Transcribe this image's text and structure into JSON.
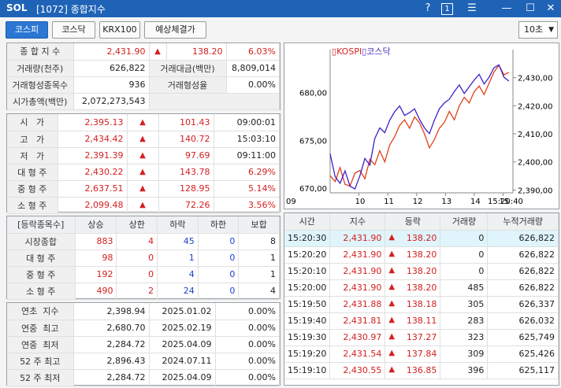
{
  "window": {
    "logo": "SOL",
    "title": "[1072] 종합지수",
    "help": "?",
    "num": "1",
    "menu": "☰",
    "min": "—",
    "max": "☐",
    "close": "✕"
  },
  "tabs": [
    "코스피",
    "코스닥",
    "KRX100",
    "예상체결가"
  ],
  "interval": "10초",
  "summary": {
    "rows": [
      {
        "label": "종 합 지 수",
        "v1": "2,431.90",
        "arrow": "▲",
        "v2": "138.20",
        "v3": "6.03%"
      },
      {
        "label": "거래량(천주)",
        "v1": "626,822",
        "label2": "거래대금(백만)",
        "v2": "8,809,014"
      },
      {
        "label": "거래형성종목수",
        "v1": "936",
        "label2": "거래형성율",
        "v2": "0.00%"
      },
      {
        "label": "시가총액(백만)",
        "v1": "2,072,273,543"
      }
    ]
  },
  "prices": [
    {
      "label": "시   가",
      "v": "2,395.13",
      "arrow": "▲",
      "chg": "101.43",
      "extra": "09:00:01"
    },
    {
      "label": "고   가",
      "v": "2,434.42",
      "arrow": "▲",
      "chg": "140.72",
      "extra": "15:03:10"
    },
    {
      "label": "저   가",
      "v": "2,391.39",
      "arrow": "▲",
      "chg": "97.69",
      "extra": "09:11:00"
    },
    {
      "label": "대 형 주",
      "v": "2,430.22",
      "arrow": "▲",
      "chg": "143.78",
      "extra": "6.29%"
    },
    {
      "label": "중 형 주",
      "v": "2,637.51",
      "arrow": "▲",
      "chg": "128.95",
      "extra": "5.14%"
    },
    {
      "label": "소 형 주",
      "v": "2,099.48",
      "arrow": "▲",
      "chg": "72.26",
      "extra": "3.56%"
    }
  ],
  "breadth": {
    "headers": [
      "[등락종목수]",
      "상승",
      "상한",
      "하락",
      "하한",
      "보합"
    ],
    "rows": [
      {
        "label": "시장종합",
        "up": "883",
        "uplim": "4",
        "down": "45",
        "downlim": "0",
        "flat": "8"
      },
      {
        "label": "대 형 주",
        "up": "98",
        "uplim": "0",
        "down": "1",
        "downlim": "0",
        "flat": "1"
      },
      {
        "label": "중 형 주",
        "up": "192",
        "uplim": "0",
        "down": "4",
        "downlim": "0",
        "flat": "1"
      },
      {
        "label": "소 형 주",
        "up": "490",
        "uplim": "2",
        "down": "24",
        "downlim": "0",
        "flat": "4"
      }
    ]
  },
  "yearly": [
    {
      "label": "연초  지수",
      "v": "2,398.94",
      "date": "2025.01.02",
      "pct": "0.00%"
    },
    {
      "label": "연중  최고",
      "v": "2,680.70",
      "date": "2025.02.19",
      "pct": "0.00%"
    },
    {
      "label": "연중  최저",
      "v": "2,284.72",
      "date": "2025.04.09",
      "pct": "0.00%"
    },
    {
      "label": "52 주 최고",
      "v": "2,896.43",
      "date": "2024.07.11",
      "pct": "0.00%"
    },
    {
      "label": "52 주 최저",
      "v": "2,284.72",
      "date": "2025.04.09",
      "pct": "0.00%"
    }
  ],
  "ticks": {
    "headers": [
      "시간",
      "지수",
      "등락",
      "거래량",
      "누적거래량"
    ],
    "rows": [
      {
        "t": "15:20:30",
        "idx": "2,431.90",
        "chg": "138.20",
        "vol": "0",
        "cum": "626,822"
      },
      {
        "t": "15:20:20",
        "idx": "2,431.90",
        "chg": "138.20",
        "vol": "0",
        "cum": "626,822"
      },
      {
        "t": "15:20:10",
        "idx": "2,431.90",
        "chg": "138.20",
        "vol": "0",
        "cum": "626,822"
      },
      {
        "t": "15:20:00",
        "idx": "2,431.90",
        "chg": "138.20",
        "vol": "485",
        "cum": "626,822"
      },
      {
        "t": "15:19:50",
        "idx": "2,431.88",
        "chg": "138.18",
        "vol": "305",
        "cum": "626,337"
      },
      {
        "t": "15:19:40",
        "idx": "2,431.81",
        "chg": "138.11",
        "vol": "283",
        "cum": "626,032"
      },
      {
        "t": "15:19:30",
        "idx": "2,430.97",
        "chg": "137.27",
        "vol": "323",
        "cum": "625,749"
      },
      {
        "t": "15:19:20",
        "idx": "2,431.54",
        "chg": "137.84",
        "vol": "309",
        "cum": "625,426"
      },
      {
        "t": "15:19:10",
        "idx": "2,430.55",
        "chg": "136.85",
        "vol": "396",
        "cum": "625,117"
      }
    ]
  },
  "chart_data": {
    "type": "line",
    "legend": [
      "KOSPI",
      "코스닥"
    ],
    "x_ticks": [
      "09",
      "10",
      "11",
      "12",
      "13",
      "14",
      "15",
      "15:20:40"
    ],
    "y_left": [
      "680,00",
      "675,00",
      "670,00"
    ],
    "y_right": [
      "2,430,00",
      "2,420,00",
      "2,410,00",
      "2,400,00",
      "2,390,00"
    ],
    "series": [
      {
        "name": "KOSPI",
        "color": "#e2401a",
        "axis": "right",
        "values": [
          2395.1,
          2393,
          2398,
          2392,
          2391.4,
          2396,
          2397,
          2394,
          2401,
          2399,
          2404,
          2400,
          2406,
          2409,
          2413,
          2415,
          2412,
          2416,
          2414,
          2410,
          2405,
          2408,
          2412,
          2414,
          2418,
          2415,
          2420,
          2423,
          2421,
          2425,
          2427,
          2424,
          2428,
          2432,
          2434.4,
          2431,
          2431.9
        ]
      },
      {
        "name": "코스닥",
        "color": "#3a22c8",
        "axis": "left",
        "values": [
          673.6,
          671.2,
          670.5,
          671.8,
          670.2,
          669.9,
          671.3,
          673.1,
          672.4,
          675.2,
          676.3,
          675.8,
          677.1,
          678.0,
          678.6,
          677.6,
          677.9,
          678.3,
          677.2,
          676.3,
          675.7,
          677.1,
          678.3,
          678.9,
          679.3,
          680.1,
          680.8,
          679.9,
          680.6,
          681.3,
          681.9,
          680.9,
          681.6,
          682.6,
          682.9,
          681.6,
          681.2
        ]
      }
    ],
    "x_range": [
      9,
      15.34
    ],
    "y_left_range": [
      669.5,
      684.5
    ],
    "y_right_range": [
      2389,
      2440
    ]
  }
}
